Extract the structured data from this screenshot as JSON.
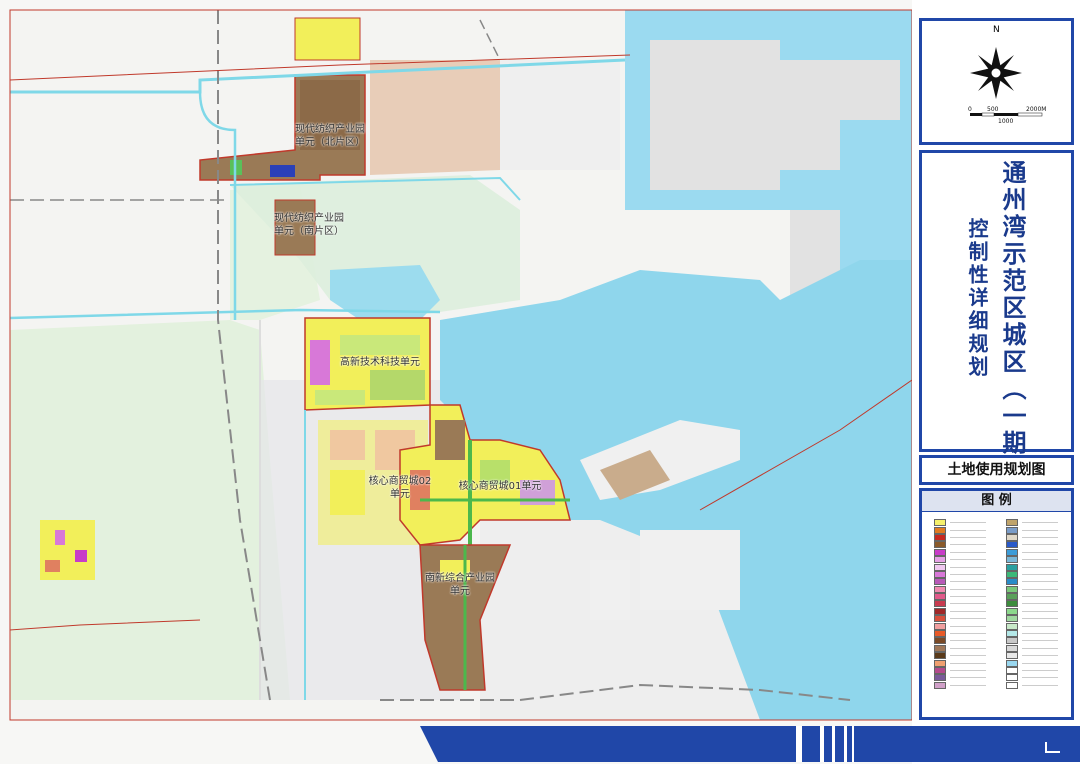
{
  "map_labels": {
    "textile_north_line1": "现代纺织产业园",
    "textile_north_line2": "单元（北片区）",
    "textile_south_line1": "现代纺织产业园",
    "textile_south_line2": "单元（南片区）",
    "tech_unit": "高新技术科技单元",
    "hub02_line1": "核心商贸城02",
    "hub02_line2": "单元",
    "hub01": "核心商贸城01单元",
    "integrated_line1": "南新综合产业园",
    "integrated_line2": "单元"
  },
  "compass": {
    "north": "N",
    "scale_0": "0",
    "scale_500": "500",
    "scale_2000": "2000M",
    "scale_1000": "1000"
  },
  "title": {
    "main": "通州湾示范区城区（一期）",
    "sub": "控制性详细规划"
  },
  "sheet_title": "土地使用规划图",
  "legend": {
    "title": "图 例",
    "swatches": [
      {
        "color": "#f5f06a"
      },
      {
        "color": "#bfa36a"
      },
      {
        "color": "#e07a20"
      },
      {
        "color": "#7a9cc8"
      },
      {
        "color": "#c8281e"
      },
      {
        "color": "#e0d8c8"
      },
      {
        "color": "#8a5a2a"
      },
      {
        "color": "#2a5ac8"
      },
      {
        "color": "#c83cc8"
      },
      {
        "color": "#3c9cd8"
      },
      {
        "color": "#e6a0e6"
      },
      {
        "color": "#7ab8d8"
      },
      {
        "color": "#f0c8f0"
      },
      {
        "color": "#2aa0a0"
      },
      {
        "color": "#d878d8"
      },
      {
        "color": "#3cb878"
      },
      {
        "color": "#b85ab8"
      },
      {
        "color": "#2a8cc8"
      },
      {
        "color": "#f08ab0"
      },
      {
        "color": "#7ac87a"
      },
      {
        "color": "#e05a8a"
      },
      {
        "color": "#5aa05a"
      },
      {
        "color": "#c83c50"
      },
      {
        "color": "#3c8c3c"
      },
      {
        "color": "#a02828"
      },
      {
        "color": "#8cd88c"
      },
      {
        "color": "#d8503c"
      },
      {
        "color": "#a0d8a0"
      },
      {
        "color": "#f0a0a0"
      },
      {
        "color": "#c8e8c8"
      },
      {
        "color": "#e85a28"
      },
      {
        "color": "#b4e8e8"
      },
      {
        "color": "#7a4a28"
      },
      {
        "color": "#c8c8c8"
      },
      {
        "color": "#a0785a"
      },
      {
        "color": "#d8d8d8"
      },
      {
        "color": "#5a3a1a"
      },
      {
        "color": "#e8e8e8"
      },
      {
        "color": "#f0a070"
      },
      {
        "color": "#9ad8f0"
      },
      {
        "color": "#b44a8c"
      },
      {
        "color": "#ffffff"
      },
      {
        "color": "#7a5a9a"
      },
      {
        "color": "#ffffff"
      },
      {
        "color": "#d0a0c8"
      },
      {
        "color": "#ffffff"
      }
    ]
  },
  "colors": {
    "water": "#8fd6ec",
    "frame_blue": "#2047a8",
    "road_cyan": "#7fd8e8",
    "boundary_red": "#c0392b",
    "residential_yellow": "#f2ef5a",
    "industrial_brown": "#a07a55",
    "green": "#6cc06c"
  }
}
